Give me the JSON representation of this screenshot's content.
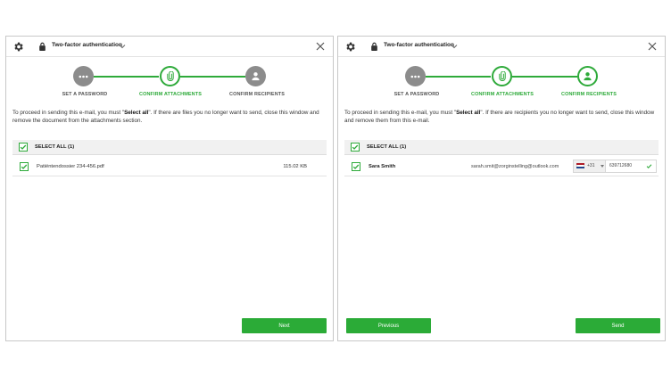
{
  "dialog_title": "Two-factor authentication",
  "steps": [
    "SET A PASSWORD",
    "CONFIRM ATTACHMENTS",
    "CONFIRM RECIPIENTS"
  ],
  "left": {
    "intro_pre": "To proceed in sending this e-mail, you must \"",
    "intro_bold": "Select all",
    "intro_post": "\". If there are files you no longer want to send, close this window and remove the document from the attachments section.",
    "select_all": "SELECT ALL (1)",
    "file_name": "Patiëntendossier 234-456.pdf",
    "file_size": "115.02 KB",
    "next_label": "Next"
  },
  "right": {
    "intro_pre": "To proceed in sending this e-mail, you must \"",
    "intro_bold": "Select all",
    "intro_post": "\". If there are recipients you no longer want to send, close this window and remove them from this e-mail.",
    "select_all": "SELECT ALL (1)",
    "recipient_name": "Sara Smith",
    "recipient_email": "sarah.smit@zorginstelling@outlook.com",
    "phone_prefix": "+31",
    "phone_number": "639712680",
    "previous_label": "Previous",
    "send_label": "Send"
  },
  "colors": {
    "accent": "#2bab37",
    "step_gray": "#8c8c8c"
  },
  "icons": [
    "gear-icon",
    "lock-icon",
    "chevron-down-icon",
    "close-icon",
    "dots-icon",
    "paperclip-icon",
    "user-icon",
    "check-icon",
    "flag-netherlands-icon"
  ]
}
